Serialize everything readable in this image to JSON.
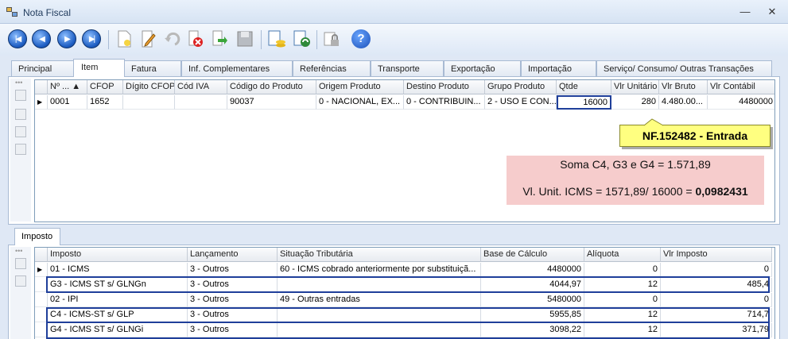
{
  "window": {
    "title": "Nota Fiscal",
    "icon": "app-window-icon",
    "minimize": "minimize-icon",
    "close": "close-icon"
  },
  "toolbar": {
    "icons": [
      "first-record-icon",
      "previous-record-icon",
      "next-record-icon",
      "last-record-icon",
      "new-document-icon",
      "edit-pencil-icon",
      "undo-icon",
      "delete-icon",
      "import-icon",
      "save-disk-icon",
      "stack-coins-icon",
      "refresh-report-icon",
      "lock-icon",
      "help-icon"
    ]
  },
  "tabs": [
    "Principal",
    "Item",
    "Fatura",
    "Inf. Complementares",
    "Referências",
    "Transporte",
    "Exportação",
    "Importação",
    "Serviço/ Consumo/ Outras Transações"
  ],
  "items_grid": {
    "headers": [
      "Nº ...",
      "CFOP",
      "Dígito CFOP",
      "Cód IVA",
      "Código do Produto",
      "Origem Produto",
      "Destino Produto",
      "Grupo Produto",
      "Qtde",
      "Vlr Unitário",
      "Vlr Bruto",
      "Vlr Contábil"
    ],
    "rows": [
      [
        "0001",
        "1652",
        "",
        "",
        "90037",
        "0 - NACIONAL, EX...",
        "0 - CONTRIBUIN...",
        "2 - USO E CON...",
        "16000",
        "280",
        "4.480.00...",
        "4480000"
      ]
    ]
  },
  "callout": "NF.152482 - Entrada",
  "note": {
    "line1": "Soma C4, G3 e G4 = 1.571,89",
    "line2_prefix": "Vl. Unit. ICMS = 1571,89/ 16000 = ",
    "line2_result": "0,0982431"
  },
  "imposto_tab": "Imposto",
  "imposto_grid": {
    "headers": [
      "Imposto",
      "Lançamento",
      "Situação Tributária",
      "Base de Cálculo",
      "Alíquota",
      "Vlr Imposto"
    ],
    "rows": [
      [
        "01 - ICMS",
        "3 - Outros",
        "60 - ICMS cobrado anteriormente por substituiçã...",
        "4480000",
        "0",
        "0"
      ],
      [
        "G3 - ICMS ST s/ GLNGn",
        "3 - Outros",
        "",
        "4044,97",
        "12",
        "485,4"
      ],
      [
        "02 - IPI",
        "3 - Outros",
        "49 - Outras entradas",
        "5480000",
        "0",
        "0"
      ],
      [
        "C4 - ICMS-ST s/ GLP",
        "3 - Outros",
        "",
        "5955,85",
        "12",
        "714,7"
      ],
      [
        "G4 - ICMS ST s/ GLNGi",
        "3 - Outros",
        "",
        "3098,22",
        "12",
        "371,79"
      ]
    ]
  }
}
